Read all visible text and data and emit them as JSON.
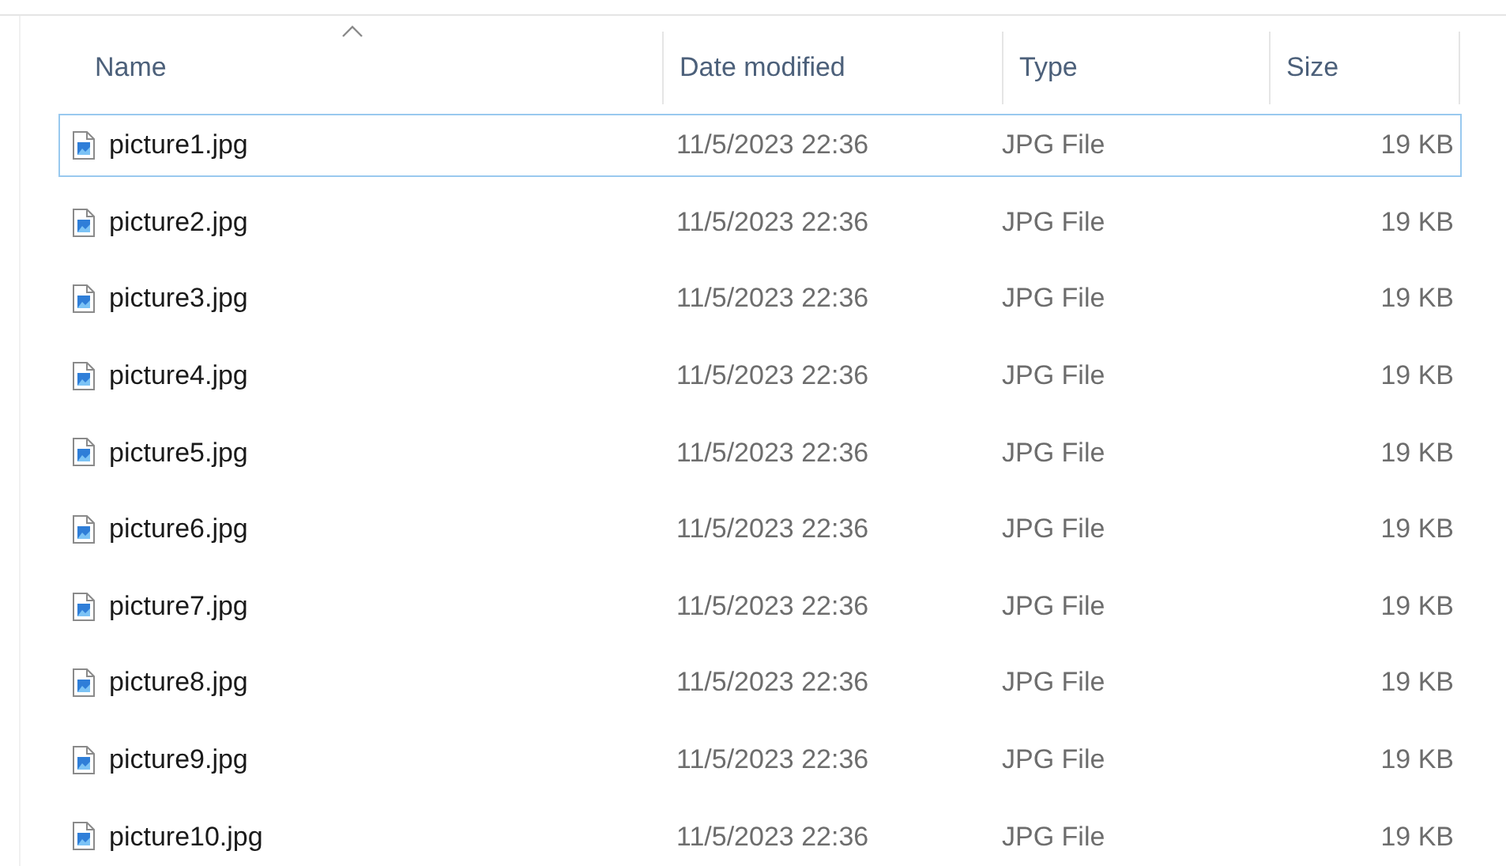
{
  "columns": [
    {
      "label": "Name",
      "sorted": true
    },
    {
      "label": "Date modified",
      "sorted": false
    },
    {
      "label": "Type",
      "sorted": false
    },
    {
      "label": "Size",
      "sorted": false
    }
  ],
  "rows": [
    {
      "name": "picture1.jpg",
      "date": "11/5/2023 22:36",
      "type": "JPG File",
      "size": "19 KB",
      "focused": true
    },
    {
      "name": "picture2.jpg",
      "date": "11/5/2023 22:36",
      "type": "JPG File",
      "size": "19 KB",
      "focused": false
    },
    {
      "name": "picture3.jpg",
      "date": "11/5/2023 22:36",
      "type": "JPG File",
      "size": "19 KB",
      "focused": false
    },
    {
      "name": "picture4.jpg",
      "date": "11/5/2023 22:36",
      "type": "JPG File",
      "size": "19 KB",
      "focused": false
    },
    {
      "name": "picture5.jpg",
      "date": "11/5/2023 22:36",
      "type": "JPG File",
      "size": "19 KB",
      "focused": false
    },
    {
      "name": "picture6.jpg",
      "date": "11/5/2023 22:36",
      "type": "JPG File",
      "size": "19 KB",
      "focused": false
    },
    {
      "name": "picture7.jpg",
      "date": "11/5/2023 22:36",
      "type": "JPG File",
      "size": "19 KB",
      "focused": false
    },
    {
      "name": "picture8.jpg",
      "date": "11/5/2023 22:36",
      "type": "JPG File",
      "size": "19 KB",
      "focused": false
    },
    {
      "name": "picture9.jpg",
      "date": "11/5/2023 22:36",
      "type": "JPG File",
      "size": "19 KB",
      "focused": false
    },
    {
      "name": "picture10.jpg",
      "date": "11/5/2023 22:36",
      "type": "JPG File",
      "size": "19 KB",
      "focused": false
    }
  ]
}
